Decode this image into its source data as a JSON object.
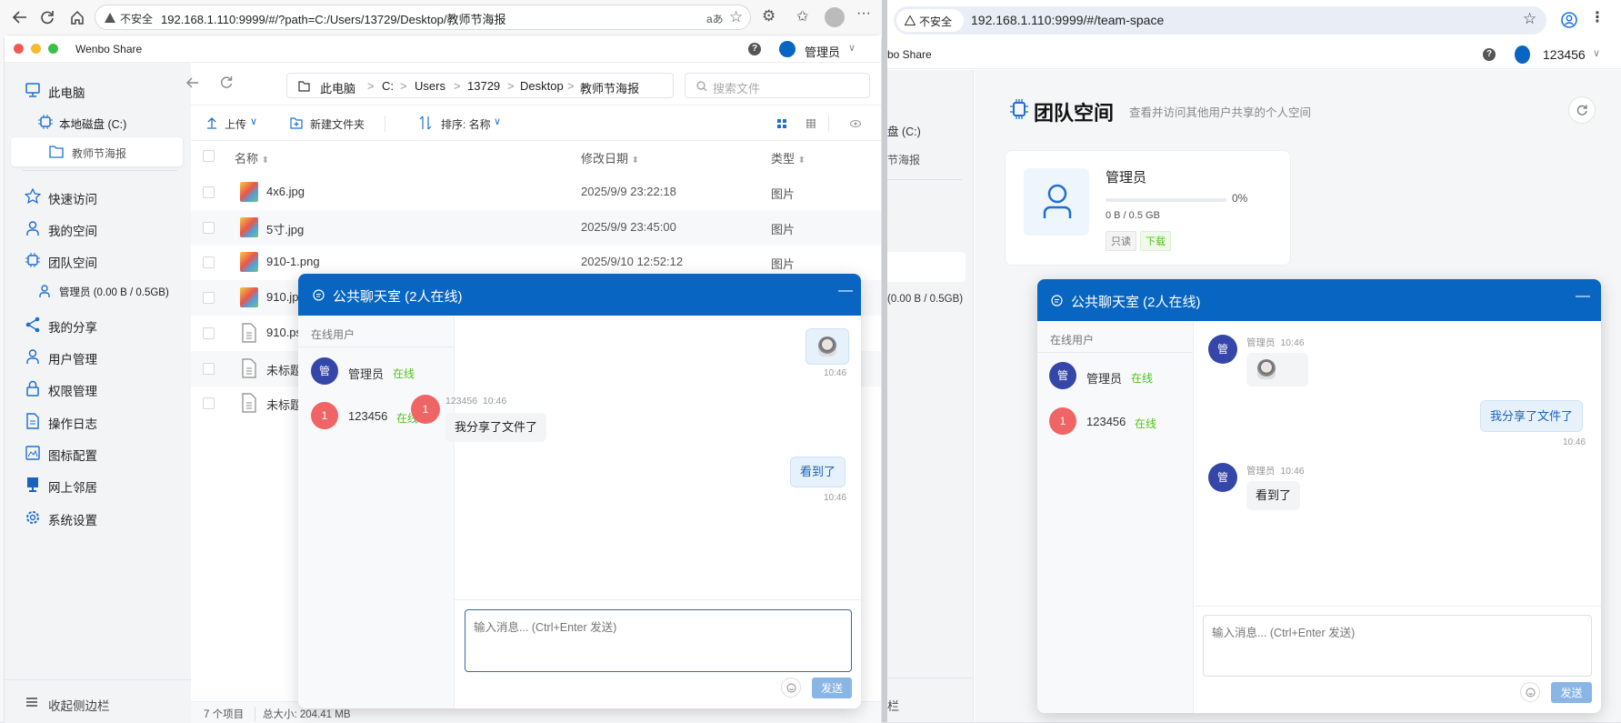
{
  "left_browser": {
    "security_label": "不安全",
    "url": "192.168.1.110:9999/#/?path=C:/Users/13729/Desktop/教师节海报",
    "app": {
      "title": "Wenbo Share",
      "user": "管理员",
      "sidebar": {
        "items": [
          {
            "label": "此电脑",
            "icon": "monitor-icon"
          },
          {
            "label": "本地磁盘 (C:)",
            "icon": "chip-icon"
          },
          {
            "label": "教师节海报",
            "icon": "folder-icon",
            "selected": true
          },
          {
            "label": "快速访问",
            "icon": "star-icon"
          },
          {
            "label": "我的空间",
            "icon": "user-icon"
          },
          {
            "label": "团队空间",
            "icon": "chip-icon"
          },
          {
            "label": "管理员 (0.00 B / 0.5GB)",
            "icon": "user-icon"
          },
          {
            "label": "我的分享",
            "icon": "share-icon"
          },
          {
            "label": "用户管理",
            "icon": "user-icon"
          },
          {
            "label": "权限管理",
            "icon": "lock-icon"
          },
          {
            "label": "操作日志",
            "icon": "document-icon"
          },
          {
            "label": "图标配置",
            "icon": "image-icon"
          },
          {
            "label": "网上邻居",
            "icon": "computer-icon"
          },
          {
            "label": "系统设置",
            "icon": "gear-icon"
          }
        ],
        "collapse_label": "收起侧边栏"
      },
      "breadcrumb": [
        "此电脑",
        "C:",
        "Users",
        "13729",
        "Desktop",
        "教师节海报"
      ],
      "search_placeholder": "搜索文件",
      "toolbar": {
        "upload": "上传",
        "new_folder": "新建文件夹",
        "sort": "排序: 名称"
      },
      "columns": {
        "name": "名称",
        "modified": "修改日期",
        "type": "类型"
      },
      "files": [
        {
          "name": "4x6.jpg",
          "modified": "2025/9/9 23:22:18",
          "type": "图片",
          "kind": "image"
        },
        {
          "name": "5寸.jpg",
          "modified": "2025/9/9 23:45:00",
          "type": "图片",
          "kind": "image"
        },
        {
          "name": "910-1.png",
          "modified": "2025/9/10 12:52:12",
          "type": "图片",
          "kind": "image"
        },
        {
          "name": "910.jp",
          "kind": "image"
        },
        {
          "name": "910.ps",
          "kind": "document"
        },
        {
          "name": "未标题",
          "kind": "document"
        },
        {
          "name": "未标题",
          "kind": "document"
        }
      ],
      "status": {
        "count": "7 个项目",
        "size": "总大小: 204.41 MB"
      }
    },
    "chat": {
      "title": "公共聊天室 (2人在线)",
      "online_header": "在线用户",
      "users": [
        {
          "avatar": "管",
          "name": "管理员",
          "status": "在线"
        },
        {
          "avatar": "1",
          "name": "123456",
          "status": "在线"
        }
      ],
      "messages": [
        {
          "self": true,
          "type": "sticker",
          "time": "10:46"
        },
        {
          "self": false,
          "avatar": "1",
          "sender": "123456",
          "time": "10:46",
          "text": "我分享了文件了"
        },
        {
          "self": true,
          "text": "看到了",
          "time": "10:46"
        }
      ],
      "input_placeholder": "输入消息... (Ctrl+Enter 发送)",
      "send": "发送"
    }
  },
  "right_browser": {
    "security_label": "不安全",
    "url": "192.168.1.110:9999/#/team-space",
    "app": {
      "title_fragment": "bo Share",
      "user": "123456",
      "sidebar_fragments": [
        "盘 (C:)",
        "节海报",
        "(0.00 B / 0.5GB)",
        "栏"
      ],
      "page_title": "团队空间",
      "page_subtitle": "查看并访问其他用户共享的个人空间",
      "card": {
        "name": "管理员",
        "usage_percent": 0,
        "usage_label": "0%",
        "usage_text": "0 B / 0.5 GB",
        "tags": [
          "只读",
          "下载"
        ]
      }
    },
    "chat": {
      "title": "公共聊天室 (2人在线)",
      "online_header": "在线用户",
      "users": [
        {
          "avatar": "管",
          "name": "管理员",
          "status": "在线"
        },
        {
          "avatar": "1",
          "name": "123456",
          "status": "在线"
        }
      ],
      "messages": [
        {
          "self": false,
          "avatar": "管",
          "sender": "管理员",
          "time": "10:46",
          "type": "sticker"
        },
        {
          "self": true,
          "text": "我分享了文件了",
          "time": "10:46"
        },
        {
          "self": false,
          "avatar": "管",
          "sender": "管理员",
          "time": "10:46",
          "text": "看到了"
        }
      ],
      "input_placeholder": "输入消息... (Ctrl+Enter 发送)",
      "send": "发送"
    }
  },
  "colors": {
    "accent": "#0865c1",
    "online": "#52c41a",
    "avatar_admin": "#3446a8",
    "avatar_user": "#ef6464",
    "send_disabled": "#8ab6e6"
  }
}
